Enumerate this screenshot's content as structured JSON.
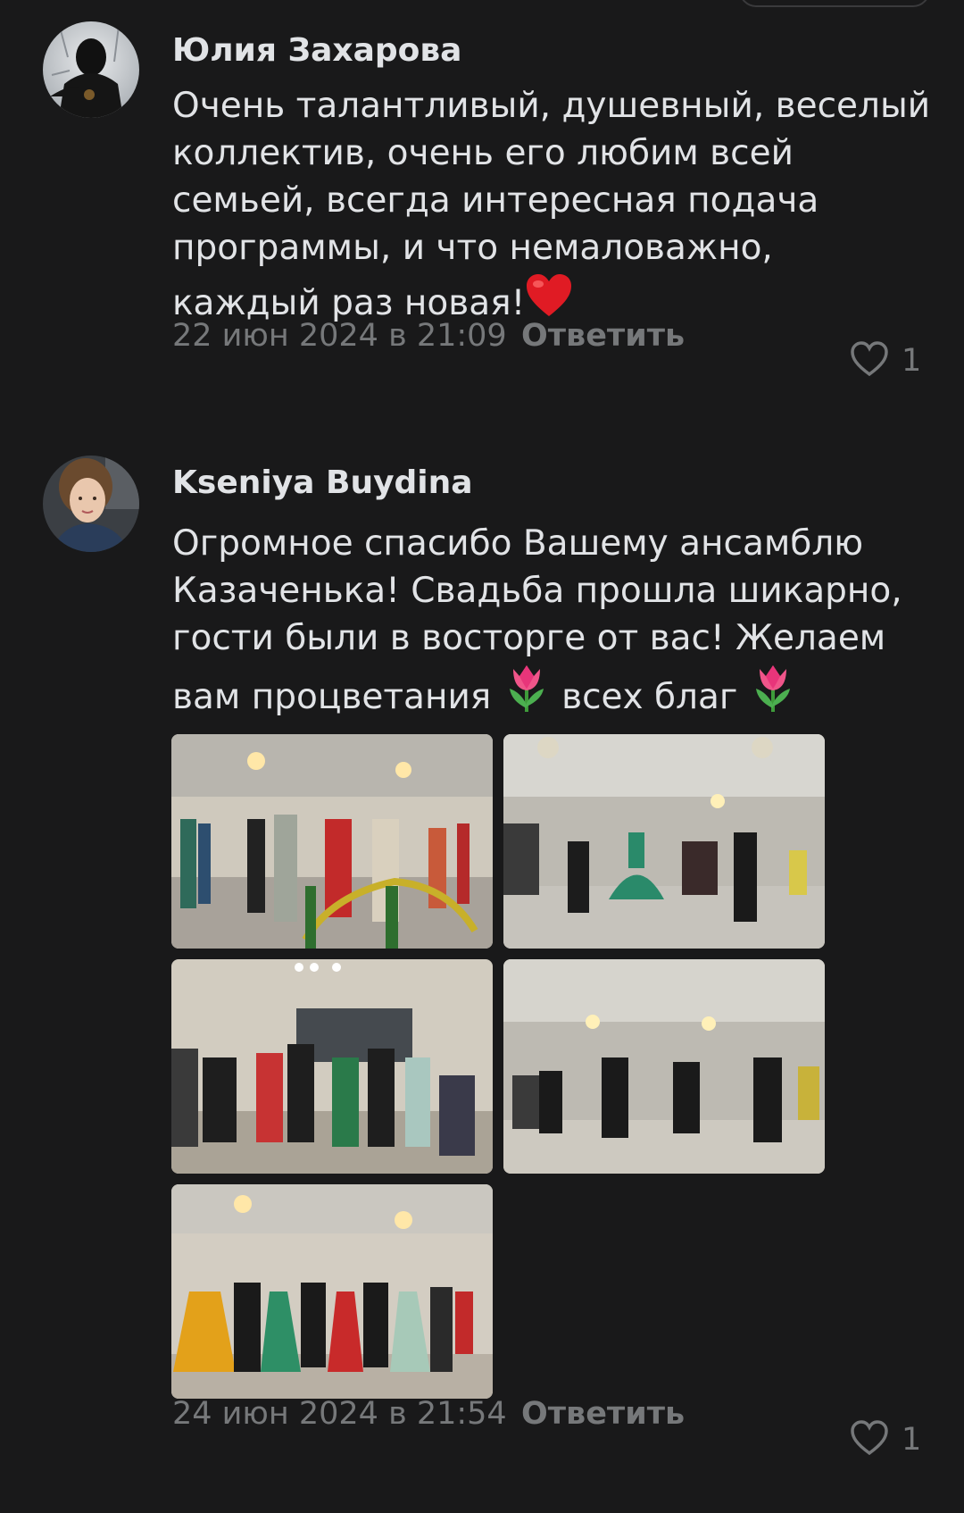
{
  "comments": [
    {
      "author": "Юлия Захарова",
      "text": "Очень талантливый, душевный, веселый коллектив, очень его любим всей семьей, всегда интересная подача программы, и что немаловажно, каждый раз новая!",
      "emoji": "red-heart",
      "date": "22 июн 2024 в 21:09",
      "reply_label": "Ответить",
      "likes": "1"
    },
    {
      "author": "Kseniya Buydina",
      "text_parts": [
        "Огромное спасибо Вашему ансамблю Казаченька! Свадьба прошла шикарно, гости были в восторге от вас! Желаем вам процветания",
        "всех благ"
      ],
      "emoji": "tulip",
      "date": "24 июн 2024 в 21:54",
      "reply_label": "Ответить",
      "likes": "1",
      "photos": [
        "photo-dance-1",
        "photo-dance-2",
        "photo-dance-3",
        "photo-dance-4",
        "photo-dance-5"
      ]
    }
  ],
  "icons": {
    "like": "heart-outline-icon"
  },
  "colors": {
    "background": "#19191a",
    "text": "#e1e3e6",
    "secondary": "#76787a"
  }
}
